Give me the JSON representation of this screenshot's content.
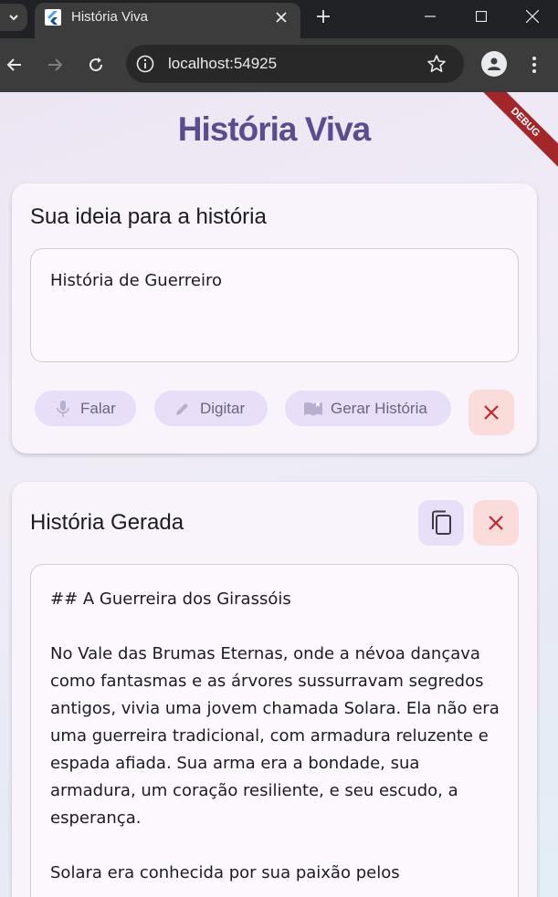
{
  "browser": {
    "tab_title": "História Viva",
    "url": "localhost:54925"
  },
  "app": {
    "title": "História Viva",
    "debug_banner": "DEBUG"
  },
  "idea_card": {
    "title": "Sua ideia para a história",
    "input_value": "História de Guerreiro",
    "buttons": {
      "speak": "Falar",
      "type": "Digitar",
      "generate": "Gerar História"
    }
  },
  "story_card": {
    "title": "História Gerada",
    "story_lines": "## A Guerreira dos Girassóis\n\nNo Vale das Brumas Eternas, onde a névoa dançava como fantasmas e as árvores sussurravam segredos antigos, vivia uma jovem chamada Solara. Ela não era uma guerreira tradicional, com armadura reluzente e espada afiada. Sua arma era a bondade, sua armadura, um coração resiliente, e seu escudo, a esperança.\n\nSolara era conhecida por sua paixão pelos"
  },
  "colors": {
    "brand": "#5a4c8e",
    "pill_bg": "#e8def8",
    "danger_bg": "#fadcda",
    "danger_icon": "#c0272d"
  },
  "icons": [
    "chevron-down-icon",
    "flutter-logo-icon",
    "close-icon",
    "plus-icon",
    "minimize-icon",
    "maximize-icon",
    "back-arrow-icon",
    "forward-arrow-icon",
    "reload-icon",
    "info-icon",
    "star-icon",
    "profile-icon",
    "kebab-menu-icon",
    "mic-icon",
    "pencil-icon",
    "book-icon",
    "copy-icon"
  ]
}
